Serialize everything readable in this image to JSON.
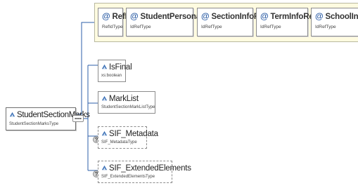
{
  "root": {
    "name": "StudentSectionMarks",
    "type": "StudentSectionMarksType"
  },
  "attributes": [
    {
      "name": "RefId",
      "type": "RefIdType",
      "icon": "at-sign-icon"
    },
    {
      "name": "StudentPersonalRefId",
      "type": "IdRefType",
      "icon": "at-sign-icon"
    },
    {
      "name": "SectionInfoRefId",
      "type": "IdRefType",
      "icon": "at-sign-icon"
    },
    {
      "name": "TermInfoRefId",
      "type": "IdRefType",
      "icon": "at-sign-icon"
    },
    {
      "name": "SchoolInfoRefId",
      "type": "IdRefType",
      "icon": "at-sign-icon"
    }
  ],
  "elements": [
    {
      "name": "IsFinal",
      "type": "xs:boolean",
      "optional": false
    },
    {
      "name": "MarkList",
      "type": "StudentSectionMarkListType",
      "optional": false
    },
    {
      "name": "SIF_Metadata",
      "type": "SIF_MetadataType",
      "optional": true,
      "occurrence_glyph": "?"
    },
    {
      "name": "SIF_ExtendedElements",
      "type": "SIF_ExtendedElementsType",
      "optional": true,
      "occurrence_glyph": "?"
    }
  ],
  "colors": {
    "attr_group_bg": "#fffbe0",
    "connector": "#2d5fa8",
    "attr_icon": "#2f5fa6"
  }
}
